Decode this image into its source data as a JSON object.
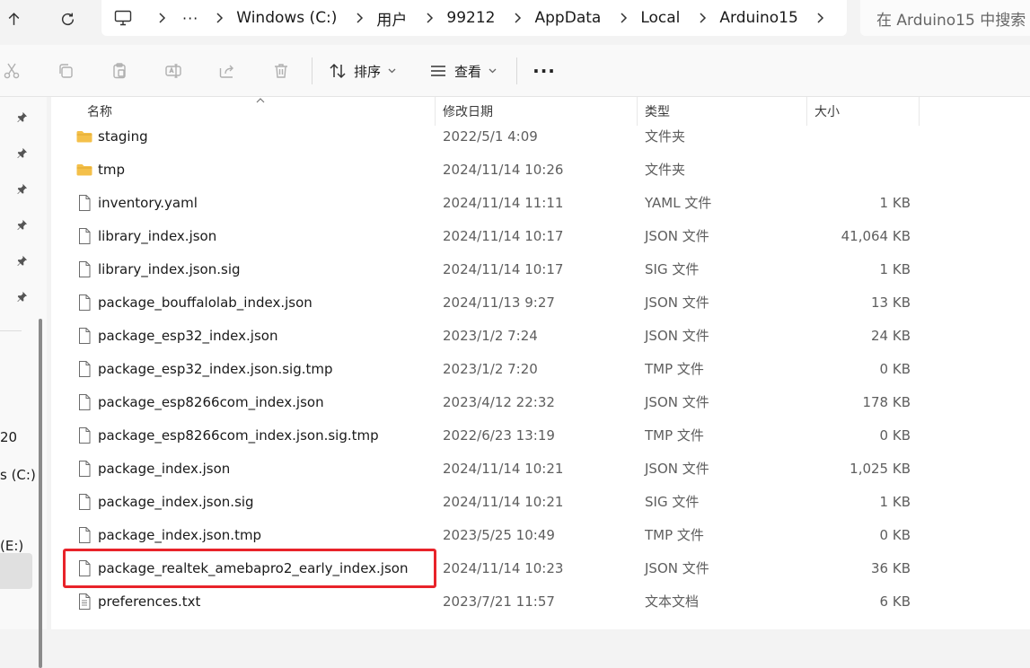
{
  "address_bar": {
    "more_label": "···",
    "crumbs": [
      "Windows (C:)",
      "用户",
      "99212",
      "AppData",
      "Local",
      "Arduino15"
    ],
    "search_placeholder": "在 Arduino15 中搜索"
  },
  "command_bar": {
    "sort_label": "排序",
    "view_label": "查看",
    "more_label": "···"
  },
  "nav_pane": {
    "fragments": [
      "20",
      "s (C:)",
      "(E:)"
    ]
  },
  "columns": {
    "name": "名称",
    "date": "修改日期",
    "type": "类型",
    "size": "大小"
  },
  "files": [
    {
      "name": "staging",
      "date": "2022/5/1 4:09",
      "type": "文件夹",
      "size": "",
      "kind": "folder"
    },
    {
      "name": "tmp",
      "date": "2024/11/14 10:26",
      "type": "文件夹",
      "size": "",
      "kind": "folder"
    },
    {
      "name": "inventory.yaml",
      "date": "2024/11/14 11:11",
      "type": "YAML 文件",
      "size": "1 KB",
      "kind": "file"
    },
    {
      "name": "library_index.json",
      "date": "2024/11/14 10:17",
      "type": "JSON 文件",
      "size": "41,064 KB",
      "kind": "file"
    },
    {
      "name": "library_index.json.sig",
      "date": "2024/11/14 10:17",
      "type": "SIG 文件",
      "size": "1 KB",
      "kind": "file"
    },
    {
      "name": "package_bouffalolab_index.json",
      "date": "2024/11/13 9:27",
      "type": "JSON 文件",
      "size": "13 KB",
      "kind": "file"
    },
    {
      "name": "package_esp32_index.json",
      "date": "2023/1/2 7:24",
      "type": "JSON 文件",
      "size": "24 KB",
      "kind": "file"
    },
    {
      "name": "package_esp32_index.json.sig.tmp",
      "date": "2023/1/2 7:20",
      "type": "TMP 文件",
      "size": "0 KB",
      "kind": "file"
    },
    {
      "name": "package_esp8266com_index.json",
      "date": "2023/4/12 22:32",
      "type": "JSON 文件",
      "size": "178 KB",
      "kind": "file"
    },
    {
      "name": "package_esp8266com_index.json.sig.tmp",
      "date": "2022/6/23 13:19",
      "type": "TMP 文件",
      "size": "0 KB",
      "kind": "file"
    },
    {
      "name": "package_index.json",
      "date": "2024/11/14 10:21",
      "type": "JSON 文件",
      "size": "1,025 KB",
      "kind": "file"
    },
    {
      "name": "package_index.json.sig",
      "date": "2024/11/14 10:21",
      "type": "SIG 文件",
      "size": "1 KB",
      "kind": "file"
    },
    {
      "name": "package_index.json.tmp",
      "date": "2023/5/25 10:49",
      "type": "TMP 文件",
      "size": "0 KB",
      "kind": "file"
    },
    {
      "name": "package_realtek_amebapro2_early_index.json",
      "date": "2024/11/14 10:23",
      "type": "JSON 文件",
      "size": "36 KB",
      "kind": "file"
    },
    {
      "name": "preferences.txt",
      "date": "2023/7/21 11:57",
      "type": "文本文档",
      "size": "6 KB",
      "kind": "text"
    }
  ],
  "colors": {
    "highlight": "#e8232a",
    "folder": "#f4c04a"
  }
}
